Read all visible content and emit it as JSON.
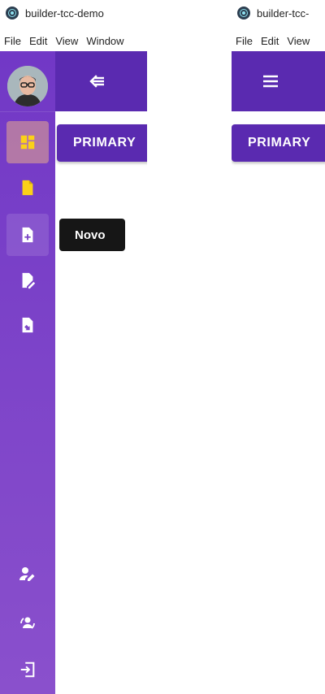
{
  "windows": [
    {
      "title": "builder-tcc-demo",
      "menu": [
        "File",
        "Edit",
        "View",
        "Window"
      ],
      "appbar_icon": "arrow-collapse-left-icon",
      "primary_button_label": "PRIMARY",
      "sidebar": {
        "items": [
          {
            "icon": "dashboard-icon",
            "state": "selected",
            "color": "#fbd118"
          },
          {
            "icon": "file-icon",
            "color": "#fbd118"
          },
          {
            "icon": "file-plus-icon",
            "state": "hover",
            "tooltip": "Novo"
          },
          {
            "icon": "file-edit-icon"
          },
          {
            "icon": "file-move-icon"
          }
        ],
        "bottom_items": [
          {
            "icon": "account-edit-icon"
          },
          {
            "icon": "account-sync-icon"
          },
          {
            "icon": "logout-icon"
          }
        ]
      }
    },
    {
      "title": "builder-tcc-",
      "menu": [
        "File",
        "Edit",
        "View"
      ],
      "appbar_icon": "menu-icon",
      "primary_button_label": "PRIMARY"
    }
  ],
  "tooltip": {
    "text": "Novo"
  },
  "colors": {
    "appbar": "#5a2ab0",
    "sidebar_top": "#7138c6",
    "sidebar_bottom": "#8a50cc",
    "accent": "#fbd118",
    "tooltip_bg": "#161616"
  }
}
